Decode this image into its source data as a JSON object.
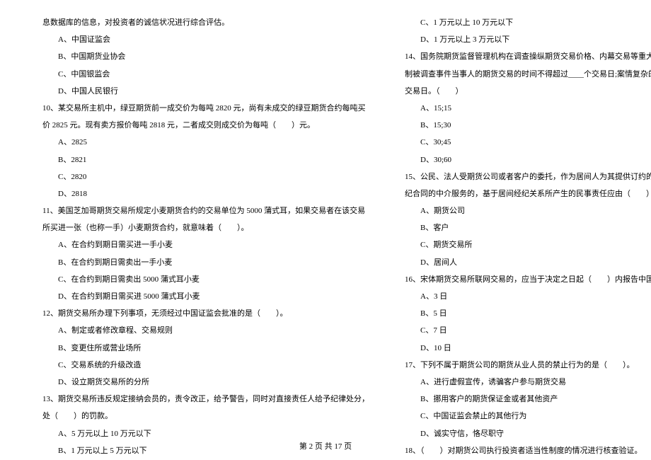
{
  "left": {
    "intro": "息数据库的信息，对投资者的诚信状况进行综合评估。",
    "q10_opts_prefix": [
      "A、中国证监会",
      "B、中国期货业协会",
      "C、中国银监会",
      "D、中国人民银行"
    ],
    "q10": "10、某交易所主机中，绿豆期货前一成交价为每吨 2820 元，尚有未成交的绿豆期货合约每吨买",
    "q10b": "价 2825 元。现有卖方报价每吨 2818 元，二者成交则成交价为每吨（　　）元。",
    "q10_opts": [
      "A、2825",
      "B、2821",
      "C、2820",
      "D、2818"
    ],
    "q11": "11、美国芝加哥期货交易所规定小麦期货合约的交易单位为 5000 蒲式耳，如果交易者在该交易",
    "q11b": "所买进一张（也称一手）小麦期货合约，就意味着（　　）。",
    "q11_opts": [
      "A、在合约到期日需买进一手小麦",
      "B、在合约到期日需卖出一手小麦",
      "C、在合约到期日需卖出 5000 蒲式耳小麦",
      "D、在合约到期日需买进 5000 蒲式耳小麦"
    ],
    "q12": "12、期货交易所办理下列事项，无须经过中国证监会批准的是（　　）。",
    "q12_opts": [
      "A、制定或者修改章程、交易规则",
      "B、变更住所或营业场所",
      "C、交易系统的升级改造",
      "D、设立期货交易所的分所"
    ],
    "q13": "13、期货交易所违反规定接纳会员的，责令改正，给予警告，同时对直接责任人给予纪律处分，",
    "q13b": "处（　　）的罚款。",
    "q13_opts": [
      "A、5 万元以上 10 万元以下",
      "B、1 万元以上 5 万元以下"
    ]
  },
  "right": {
    "q13_opts_cont": [
      "C、1 万元以上 10 万元以下",
      "D、1 万元以上 3 万元以下"
    ],
    "q14": "14、国务院期货监督管理机构在调查操纵期货交易价格、内幕交易等重大期货违法行为时，限",
    "q14b": "制被调查事件当事人的期货交易的时间不得超过____个交易日;案情复杂的，可以延长至____个",
    "q14c": "交易日。（　　）",
    "q14_opts": [
      "A、15;15",
      "B、15;30",
      "C、30;45",
      "D、30;60"
    ],
    "q15": "15、公民、法人受期货公司或者客户的委托，作为居间人为其提供订约的机会或者订立期货经",
    "q15b": "纪合同的中介服务的，基于居间经纪关系所产生的民事责任应由（　　）承担。",
    "q15_opts": [
      "A、期货公司",
      "B、客户",
      "C、期货交易所",
      "D、居间人"
    ],
    "q16": "16、宋体期货交易所联网交易的，应当于决定之日起（　　）内报告中国证监会。",
    "q16_opts": [
      "A、3 日",
      "B、5 日",
      "C、7 日",
      "D、10 日"
    ],
    "q17": "17、下列不属于期货公司的期货从业人员的禁止行为的是（　　）。",
    "q17_opts": [
      "A、进行虚假宣传，诱骗客户参与期货交易",
      "B、挪用客户的期货保证金或者其他资产",
      "C、中国证监会禁止的其他行为",
      "D、诚实守信，恪尽职守"
    ],
    "q18": "18、（　　）对期货公司执行投资者适当性制度的情况进行核查验证。"
  },
  "footer": "第 2 页 共 17 页"
}
